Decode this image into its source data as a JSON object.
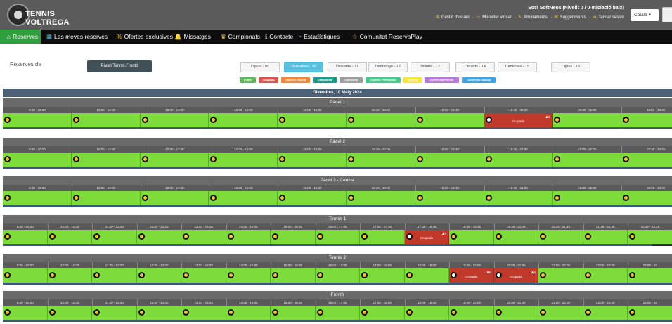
{
  "header": {
    "logo_text": "TENNIS VOLTREGA",
    "user_name": "Soci SoftNeos (Nivell: 0 / 0-Iniciació baix)",
    "links": [
      "Gestió d'usuari",
      "Moneder virtual",
      "Abonaments",
      "Suggeriments",
      "Tancar sessió"
    ],
    "language": "Català ▾"
  },
  "nav": [
    {
      "icon": "home-icon",
      "label": "Reserves",
      "active": true
    },
    {
      "icon": "calendar-icon",
      "label": "Les meves reserves",
      "active": false
    },
    {
      "icon": "percent-icon",
      "label": "Ofertes exclusives",
      "active": false
    },
    {
      "icon": "bell-icon",
      "label": "Missatges",
      "active": false
    },
    {
      "icon": "trophy-icon",
      "label": "Campionats",
      "active": false
    },
    {
      "icon": "info-icon",
      "label": "Contacte",
      "active": false
    },
    {
      "icon": "chart-icon",
      "label": "Estadístiques",
      "active": false
    },
    {
      "icon": "star-icon",
      "label": "Comunitat ReservaPlay",
      "active": false
    }
  ],
  "filters": {
    "reserves_label": "Reserves de",
    "facility_button": "Pàdel,Tennis,Frontó",
    "days": [
      {
        "label": "Dijous - 09",
        "active": false
      },
      {
        "label": "Divendres - 10",
        "active": true
      },
      {
        "label": "Dissabte - 11",
        "active": false
      },
      {
        "label": "Diumenge - 12",
        "active": false
      },
      {
        "label": "Dilluns - 13",
        "active": false
      },
      {
        "label": "Dimarts - 14",
        "active": false
      },
      {
        "label": "Dimecres - 15",
        "active": false
      },
      {
        "label": "Dijous - 16",
        "active": false
      }
    ],
    "legend": [
      {
        "label": "Lliure",
        "color": "#5cb85c"
      },
      {
        "label": "Ocupada",
        "color": "#d9534f"
      },
      {
        "label": "Classes Escola",
        "color": "#f0883a"
      },
      {
        "label": "Campionat",
        "color": "#1a9a8a"
      },
      {
        "label": "Caducada",
        "color": "#9e9e9e"
      },
      {
        "label": "Classes Particulars",
        "color": "#47c98b"
      },
      {
        "label": "Torneig",
        "color": "#f5e43a"
      },
      {
        "label": "Comercial Permet",
        "color": "#b57bd8"
      },
      {
        "label": "Comercial Manual",
        "color": "#3fa3e8"
      }
    ]
  },
  "grid": {
    "date_header": "Divendres, 10 Maig 2024",
    "busy_label": "Ocupada",
    "courts": [
      {
        "name": "Pàdel 1",
        "slots": [
          "9:00 - 10:30",
          "10:30 - 12:00",
          "12:00 - 13:30",
          "13:30 - 15:00",
          "15:00 - 16:30",
          "16:30 - 18:00",
          "18:00 - 19:30",
          "19:30 - 20:30",
          "20:30 - 22:00",
          "22:00 - 23:30",
          "23:"
        ],
        "busy": [
          7
        ]
      },
      {
        "name": "Pàdel 2",
        "slots": [
          "9:00 - 10:30",
          "10:30 - 12:00",
          "12:00 - 13:30",
          "13:30 - 15:00",
          "15:00 - 16:30",
          "16:30 - 18:00",
          "18:00 - 19:30",
          "19:30 - 21:00",
          "21:00 - 22:30",
          "22:30 - 24:00"
        ],
        "busy": []
      },
      {
        "name": "Pàdel 3 - Central",
        "slots": [
          "9:00 - 10:30",
          "10:30 - 12:00",
          "12:00 - 13:30",
          "13:30 - 15:00",
          "15:00 - 16:30",
          "16:30 - 18:00",
          "18:00 - 19:30",
          "19:30 - 21:00",
          "21:00 - 22:30",
          "22:30 - 24:00"
        ],
        "busy": []
      },
      {
        "name": "Tennis 1",
        "slots": [
          "9:00 - 10:00",
          "10:00 - 11:00",
          "11:00 - 12:00",
          "12:00 - 13:00",
          "13:00 - 14:00",
          "14:00 - 15:00",
          "15:00 - 16:00",
          "16:00 - 17:00",
          "17:00 - 17:30",
          "17:30 - 18:45",
          "18:45 - 19:45",
          "19:45 - 20:45",
          "20:45 - 21:45",
          "21:45 - 22:45",
          "22:45 - 23:45"
        ],
        "busy": [
          9
        ]
      },
      {
        "name": "Tennis 2",
        "slots": [
          "9:00 - 10:00",
          "10:00 - 11:00",
          "11:00 - 12:00",
          "12:00 - 13:00",
          "13:00 - 14:00",
          "14:00 - 15:00",
          "15:00 - 16:00",
          "16:00 - 17:00",
          "17:00 - 18:00",
          "18:00 - 19:00",
          "19:00 - 20:00",
          "20:00 - 21:00",
          "21:00 - 22:00",
          "22:00 - 23:00",
          "23:00 - 24"
        ],
        "busy": [
          10,
          11
        ]
      },
      {
        "name": "Frontó",
        "slots": [
          "9:00 - 10:00",
          "10:00 - 11:00",
          "11:00 - 12:00",
          "12:00 - 13:00",
          "13:00 - 14:00",
          "14:00 - 15:00",
          "15:00 - 16:00",
          "16:00 - 17:00",
          "17:00 - 18:00",
          "18:00 - 19:00",
          "19:00 - 20:00",
          "20:00 - 21:00",
          "21:00 - 22:00",
          "22:00 - 23:00",
          "23:00 - 24"
        ],
        "busy": []
      }
    ]
  }
}
